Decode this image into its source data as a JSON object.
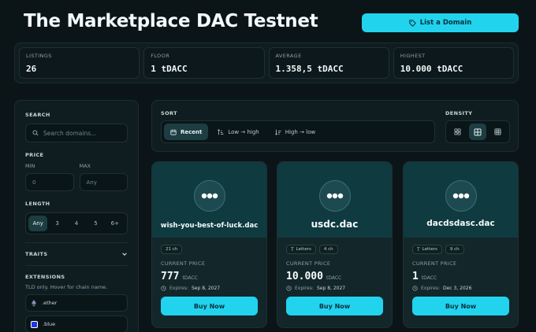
{
  "header": {
    "title": "The Marketplace DAC Testnet",
    "list_button": "List a Domain"
  },
  "stats": [
    {
      "label": "LISTINGS",
      "value": "26"
    },
    {
      "label": "FLOOR",
      "value": "1 tDACC"
    },
    {
      "label": "AVERAGE",
      "value": "1.358,5 tDACC"
    },
    {
      "label": "HIGHEST",
      "value": "10.000 tDACC"
    }
  ],
  "sidebar": {
    "search_label": "SEARCH",
    "search_placeholder": "Search domains...",
    "price_label": "PRICE",
    "min_label": "MIN",
    "max_label": "MAX",
    "min_placeholder": "0",
    "max_placeholder": "Any",
    "length_label": "LENGTH",
    "length_options": [
      "Any",
      "3",
      "4",
      "5",
      "6+"
    ],
    "traits_label": "TRAITS",
    "extensions_label": "EXTENSIONS",
    "extensions_hint": "TLD only. Hover for chain name.",
    "extensions": [
      ".ether",
      ".blue"
    ]
  },
  "sort": {
    "label": "SORT",
    "options": [
      "Recent",
      "Low → high",
      "High → low"
    ],
    "density_label": "DENSITY"
  },
  "cards": [
    {
      "name": "wish-you-best-of-luck.dac",
      "chips": [
        "21 ch"
      ],
      "price_label": "CURRENT PRICE",
      "price": "777",
      "unit": "tDACC",
      "expires_label": "Expires:",
      "expires": "Sep 8, 2027",
      "button": "Buy Now"
    },
    {
      "name": "usdc.dac",
      "chips": [
        "Letters",
        "4 ch"
      ],
      "price_label": "CURRENT PRICE",
      "price": "10.000",
      "unit": "tDACC",
      "expires_label": "Expires:",
      "expires": "Sep 8, 2027",
      "button": "Buy Now"
    },
    {
      "name": "dacdsdasc.dac",
      "chips": [
        "Letters",
        "9 ch"
      ],
      "price_label": "CURRENT PRICE",
      "price": "1",
      "unit": "tDACC",
      "expires_label": "Expires:",
      "expires": "Dec 3, 2026",
      "button": "Buy Now"
    }
  ],
  "colors": {
    "accent": "#22d3ee",
    "background": "#0b1517",
    "card_top": "#0f3a3f"
  }
}
